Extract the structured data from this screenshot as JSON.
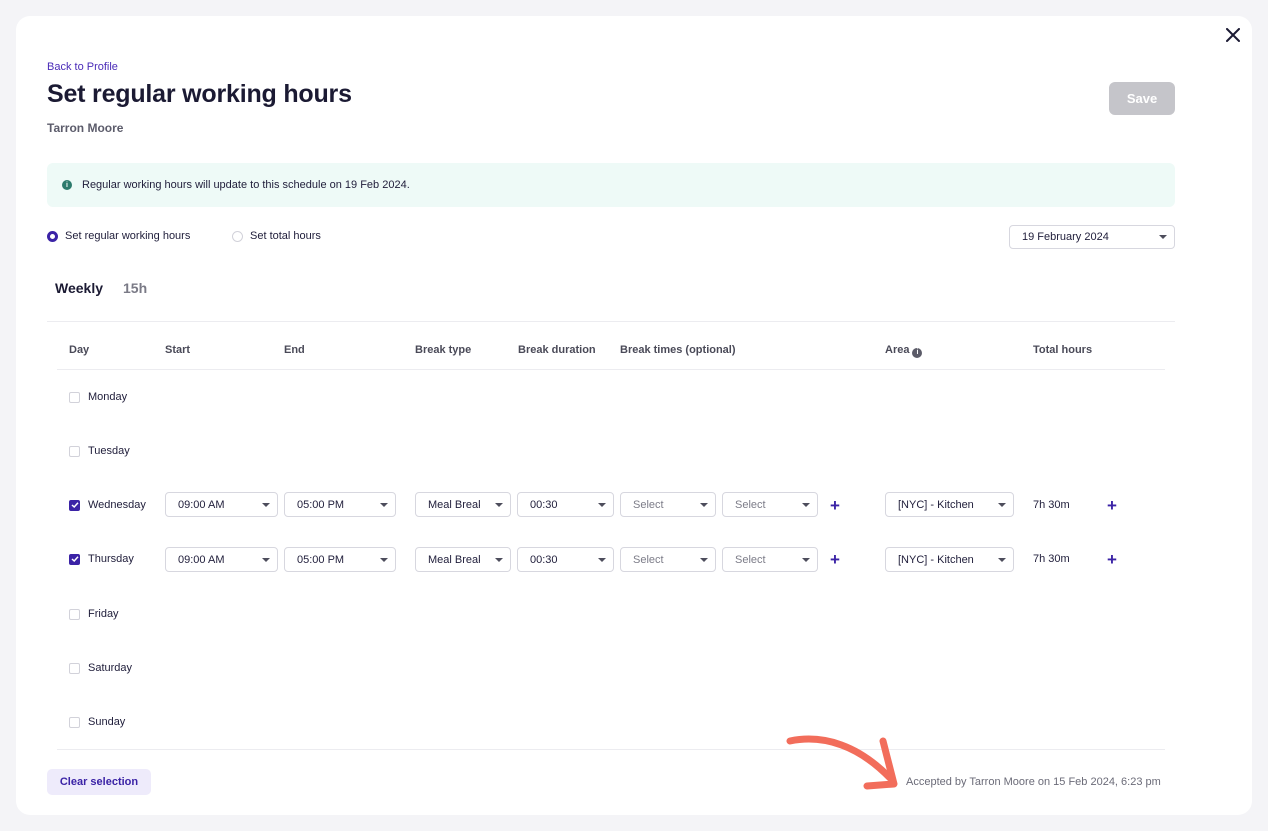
{
  "header": {
    "back_link": "Back to Profile",
    "title": "Set regular working hours",
    "employee_name": "Tarron Moore",
    "save_label": "Save"
  },
  "banner": {
    "icon": "info-icon",
    "text": "Regular working hours will update to this schedule on 19 Feb 2024."
  },
  "mode": {
    "options": [
      {
        "label": "Set regular working hours",
        "selected": true
      },
      {
        "label": "Set total hours",
        "selected": false
      }
    ],
    "effective_date": "19 February 2024"
  },
  "tabs": {
    "weekly": "Weekly",
    "total": "15h"
  },
  "table": {
    "headers": {
      "day": "Day",
      "start": "Start",
      "end": "End",
      "break_type": "Break type",
      "break_duration": "Break duration",
      "break_times": "Break times (optional)",
      "area": "Area",
      "total_hours": "Total hours"
    },
    "rows": [
      {
        "day": "Monday",
        "checked": false
      },
      {
        "day": "Tuesday",
        "checked": false
      },
      {
        "day": "Wednesday",
        "checked": true,
        "start": "09:00 AM",
        "end": "05:00 PM",
        "break_type": "Meal Break",
        "break_duration": "00:30",
        "break_start": "Select",
        "break_end": "Select",
        "area": "[NYC] - Kitchen",
        "total": "7h 30m"
      },
      {
        "day": "Thursday",
        "checked": true,
        "start": "09:00 AM",
        "end": "05:00 PM",
        "break_type": "Meal Break",
        "break_duration": "00:30",
        "break_start": "Select",
        "break_end": "Select",
        "area": "[NYC] - Kitchen",
        "total": "7h 30m"
      },
      {
        "day": "Friday",
        "checked": false
      },
      {
        "day": "Saturday",
        "checked": false
      },
      {
        "day": "Sunday",
        "checked": false
      }
    ]
  },
  "footer": {
    "clear_label": "Clear selection",
    "accepted_text": "Accepted by Tarron Moore on 15 Feb 2024, 6:23 pm"
  },
  "colors": {
    "accent": "#3b23a6",
    "banner_bg": "#eefaf7",
    "annotation_arrow": "#f26d5b"
  }
}
